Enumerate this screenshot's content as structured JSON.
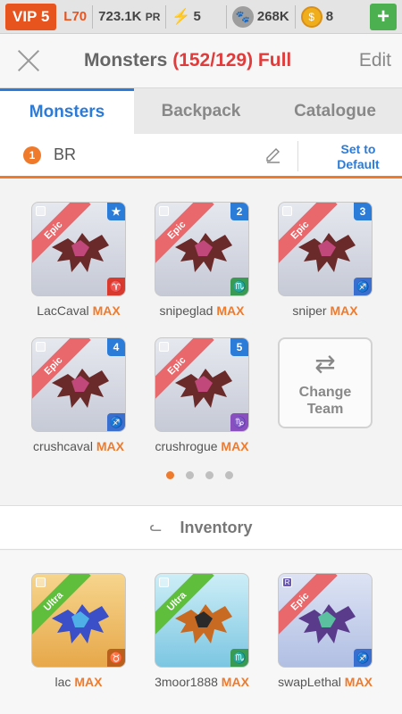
{
  "status": {
    "vip": "VIP 5",
    "level": "L70",
    "power": "723.1K",
    "power_unit": "PR",
    "energy": "5",
    "food": "268K",
    "coins": "8",
    "plus": "+"
  },
  "header": {
    "title": "Monsters",
    "count": "(152/129) Full",
    "edit": "Edit"
  },
  "tabs": [
    "Monsters",
    "Backpack",
    "Catalogue"
  ],
  "team": {
    "number": "1",
    "name": "BR",
    "set_default_line1": "Set to",
    "set_default_line2": "Default"
  },
  "team_monsters": [
    {
      "name": "LacCaval",
      "max": "MAX",
      "rarity": "Epic",
      "slot": "★",
      "sign": "♈",
      "sign_color": "#d93a2e"
    },
    {
      "name": "snipeglad",
      "max": "MAX",
      "rarity": "Epic",
      "slot": "2",
      "sign": "♏",
      "sign_color": "#3a9a52"
    },
    {
      "name": "sniper",
      "max": "MAX",
      "rarity": "Epic",
      "slot": "3",
      "sign": "♐",
      "sign_color": "#3b6fcf"
    },
    {
      "name": "crushcaval",
      "max": "MAX",
      "rarity": "Epic",
      "slot": "4",
      "sign": "♐",
      "sign_color": "#3b6fcf"
    },
    {
      "name": "crushrogue",
      "max": "MAX",
      "rarity": "Epic",
      "slot": "5",
      "sign": "♑",
      "sign_color": "#8a4fbf"
    }
  ],
  "change_team": {
    "line1": "Change",
    "line2": "Team"
  },
  "inventory_label": "Inventory",
  "inventory": [
    {
      "name": "lac",
      "max": "MAX",
      "rarity": "Ultra",
      "tag": "",
      "sign": "♉",
      "sign_color": "#b8601c"
    },
    {
      "name": "3moor1888",
      "max": "MAX",
      "rarity": "Ultra",
      "tag": "",
      "sign": "♏",
      "sign_color": "#3a9a52"
    },
    {
      "name": "swapLethal",
      "max": "MAX",
      "rarity": "Epic",
      "tag": "R",
      "sign": "♐",
      "sign_color": "#3b6fcf"
    }
  ]
}
